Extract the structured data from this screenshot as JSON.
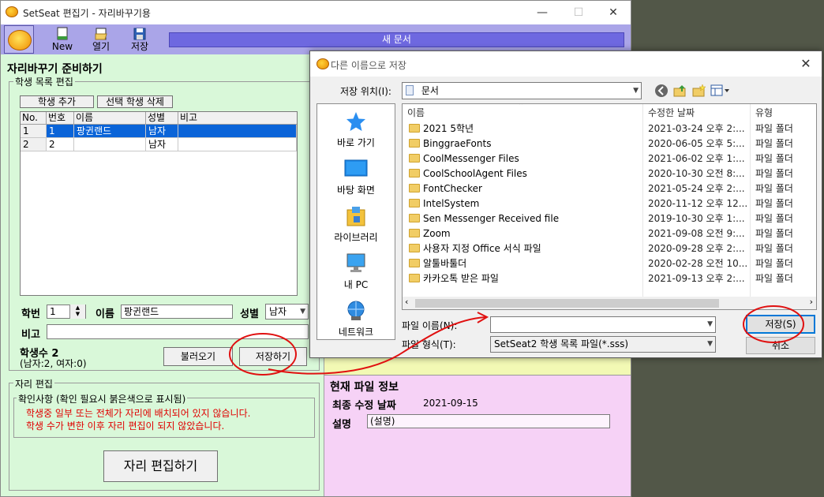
{
  "main_window": {
    "title": "SetSeat 편집기 - 자리바꾸기용",
    "toolbar": {
      "new_label": "New",
      "open_label": "열기",
      "save_label": "저장"
    },
    "doc_name": "새 문서"
  },
  "prep": {
    "title": "자리바꾸기 준비하기",
    "group_title": "학생 목록 편집",
    "add_label": "학생 추가",
    "delete_label": "선택 학생 삭제",
    "columns": [
      "No.",
      "번호",
      "이름",
      "성별",
      "비고"
    ],
    "rows": [
      {
        "no": "1",
        "num": "1",
        "name": "팡귄랜드",
        "gender": "남자",
        "note": ""
      },
      {
        "no": "2",
        "num": "2",
        "name": "",
        "gender": "남자",
        "note": ""
      }
    ],
    "num_label": "학번",
    "num_value": "1",
    "name_label": "이름",
    "name_value": "팡귄랜드",
    "gender_label": "성별",
    "gender_value": "남자",
    "note_label": "비고",
    "note_value": "",
    "count_label": "학생수 2",
    "count_detail": "(남자:2, 여자:0)",
    "load_label": "불러오기",
    "save_label": "저장하기"
  },
  "seat_edit": {
    "group_title": "자리 편집",
    "check_title": "확인사항 (확인 필요시 붉은색으로 표시됨)",
    "warnings": [
      "학생중 일부 또는 전체가 자리에 배치되어 있지 않습니다.",
      "학생 수가 변한 이후 자리 편집이 되지 않았습니다."
    ],
    "edit_button": "자리 편집하기"
  },
  "file_info": {
    "title": "현재 파일 정보",
    "modified_label": "최종 수정 날짜",
    "modified_value": "2021-09-15",
    "desc_label": "설명",
    "desc_value": "(설명)"
  },
  "dialog": {
    "title": "다른 이름으로 저장",
    "location_label": "저장 위치(I):",
    "location_value": "문서",
    "places": [
      "바로 가기",
      "바탕 화면",
      "라이브러리",
      "내 PC",
      "네트워크"
    ],
    "columns": {
      "name": "이름",
      "date": "수정한 날짜",
      "type": "유형"
    },
    "files": [
      {
        "name": "2021 5학년",
        "date": "2021-03-24 오후 2:...",
        "type": "파일 폴더"
      },
      {
        "name": "BinggraeFonts",
        "date": "2020-06-05 오후 5:...",
        "type": "파일 폴더"
      },
      {
        "name": "CoolMessenger Files",
        "date": "2021-06-02 오후 1:...",
        "type": "파일 폴더"
      },
      {
        "name": "CoolSchoolAgent Files",
        "date": "2020-10-30 오전 8:...",
        "type": "파일 폴더"
      },
      {
        "name": "FontChecker",
        "date": "2021-05-24 오후 2:...",
        "type": "파일 폴더"
      },
      {
        "name": "IntelSystem",
        "date": "2020-11-12 오후 12...",
        "type": "파일 폴더"
      },
      {
        "name": "Sen Messenger Received file",
        "date": "2019-10-30 오후 1:...",
        "type": "파일 폴더"
      },
      {
        "name": "Zoom",
        "date": "2021-09-08 오전 9:...",
        "type": "파일 폴더"
      },
      {
        "name": "사용자 지정 Office 서식 파일",
        "date": "2020-09-28 오후 2:...",
        "type": "파일 폴더"
      },
      {
        "name": "알툴바툴더",
        "date": "2020-02-28 오전 10...",
        "type": "파일 폴더"
      },
      {
        "name": "카카오톡 받은 파일",
        "date": "2021-09-13 오후 2:...",
        "type": "파일 폴더"
      }
    ],
    "filename_label": "파일 이름(N):",
    "filename_value": "",
    "filetype_label": "파일 형식(T):",
    "filetype_value": "SetSeat2 학생 목록 파일(*.sss)",
    "save_button": "저장(S)",
    "cancel_button": "취소"
  },
  "colors": {
    "toolbar": "#aaa5e8",
    "banner": "#6e68e0",
    "left_panel": "#d9f8d9",
    "pink_panel": "#f6d2f6",
    "selection": "#0a64d8",
    "annotation": "#e01010"
  }
}
